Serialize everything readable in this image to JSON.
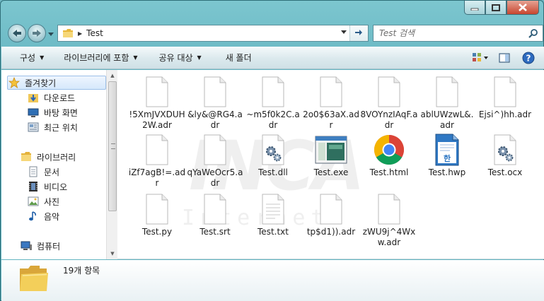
{
  "window": {
    "caption_buttons": [
      "minimize",
      "maximize",
      "close"
    ]
  },
  "address_bar": {
    "crumbs": [
      "Test"
    ]
  },
  "search": {
    "placeholder": "Test 검색"
  },
  "toolbar": {
    "organize_label": "구성",
    "include_library_label": "라이브러리에 포함",
    "share_label": "공유 대상",
    "new_folder_label": "새 폴더"
  },
  "sidebar": {
    "favorites": {
      "label": "즐겨찾기",
      "items": [
        {
          "label": "다운로드",
          "icon": "download-folder-icon"
        },
        {
          "label": "바탕 화면",
          "icon": "desktop-icon"
        },
        {
          "label": "최근 위치",
          "icon": "recent-places-icon"
        }
      ]
    },
    "libraries": {
      "label": "라이브러리",
      "items": [
        {
          "label": "문서",
          "icon": "documents-icon"
        },
        {
          "label": "비디오",
          "icon": "video-icon"
        },
        {
          "label": "사진",
          "icon": "pictures-icon"
        },
        {
          "label": "음악",
          "icon": "music-icon"
        }
      ]
    },
    "computer": {
      "label": "컴퓨터"
    }
  },
  "watermark": {
    "big": "INCA",
    "small": "Internet"
  },
  "files": [
    {
      "name": "!5XmJVXDUH2W.adr",
      "icon": "blank-file"
    },
    {
      "name": "&ly&@RG4.adr",
      "icon": "blank-file"
    },
    {
      "name": "~m5f0k2C.adr",
      "icon": "blank-file"
    },
    {
      "name": "2o0$63aX.adr",
      "icon": "blank-file"
    },
    {
      "name": "8VOYnzIAqF.adr",
      "icon": "blank-file"
    },
    {
      "name": "ablUWzwL&.adr",
      "icon": "blank-file"
    },
    {
      "name": "Ejsi^)hh.adr",
      "icon": "blank-file"
    },
    {
      "name": "iZf7agB!=.adr",
      "icon": "blank-file"
    },
    {
      "name": "qYaWeOcr5.adr",
      "icon": "blank-file"
    },
    {
      "name": "Test.dll",
      "icon": "settings-file"
    },
    {
      "name": "Test.exe",
      "icon": "exe-window"
    },
    {
      "name": "Test.html",
      "icon": "chrome"
    },
    {
      "name": "Test.hwp",
      "icon": "hwp-document"
    },
    {
      "name": "Test.ocx",
      "icon": "settings-file"
    },
    {
      "name": "Test.py",
      "icon": "blank-file"
    },
    {
      "name": "Test.srt",
      "icon": "blank-file"
    },
    {
      "name": "Test.txt",
      "icon": "text-file"
    },
    {
      "name": "tp$d1)).adr",
      "icon": "blank-file"
    },
    {
      "name": "zWU9j^4Wxw.adr",
      "icon": "blank-file"
    }
  ],
  "details": {
    "count_label": "19개 항목"
  },
  "colors": {
    "chrome_frame": "#66b7c3",
    "selection": "#d6e8fb",
    "folder_yellow": "#f3cf5a"
  }
}
